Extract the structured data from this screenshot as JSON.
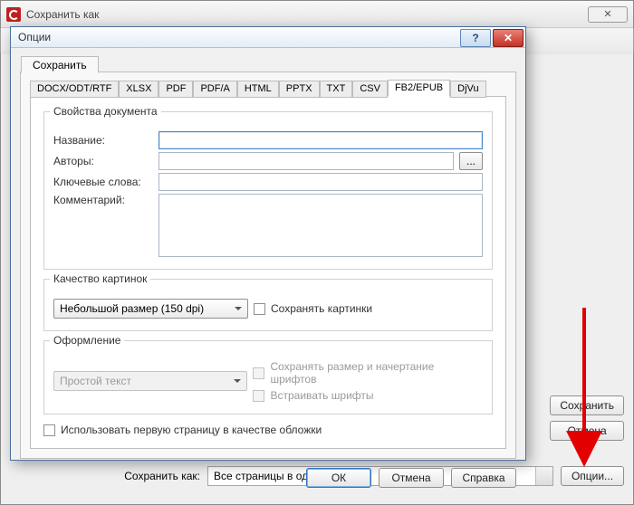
{
  "parentWindow": {
    "title": "Сохранить как",
    "saveAsLabel": "Сохранить как:",
    "saveAsSelect": "Все страницы в один файл",
    "buttons": {
      "save": "Сохранить",
      "cancel": "Отмена",
      "options": "Опции..."
    }
  },
  "modal": {
    "title": "Опции",
    "outerTab": "Сохранить",
    "formatTabs": [
      "DOCX/ODT/RTF",
      "XLSX",
      "PDF",
      "PDF/A",
      "HTML",
      "PPTX",
      "TXT",
      "CSV",
      "FB2/EPUB",
      "DjVu"
    ],
    "activeFormatTab": "FB2/EPUB",
    "section": {
      "docProps": {
        "legend": "Свойства документа",
        "name": "Название:",
        "authors": "Авторы:",
        "keywords": "Ключевые слова:",
        "comment": "Комментарий:"
      },
      "imgQuality": {
        "legend": "Качество картинок",
        "combo": "Небольшой размер (150 dpi)",
        "savePics": "Сохранять картинки"
      },
      "layout": {
        "legend": "Оформление",
        "combo": "Простой текст",
        "keepFonts": "Сохранять размер и начертание шрифтов",
        "embedFonts": "Встраивать шрифты"
      },
      "cover": "Использовать первую страницу в качестве обложки"
    },
    "buttons": {
      "ok": "ОК",
      "cancel": "Отмена",
      "help": "Справка"
    },
    "values": {
      "name": "",
      "authors": "",
      "keywords": "",
      "comment": ""
    }
  }
}
